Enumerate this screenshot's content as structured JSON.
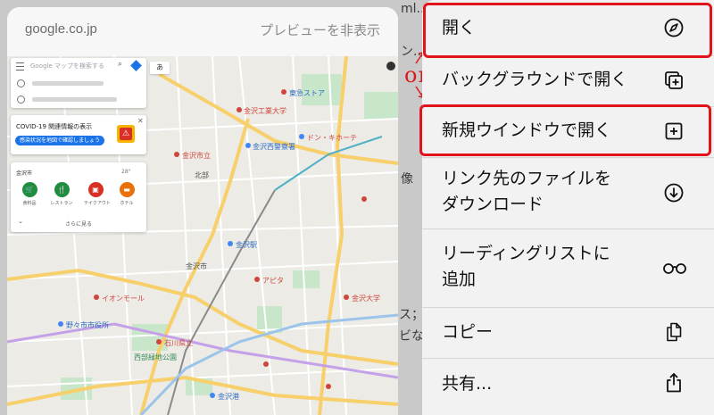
{
  "background": {
    "fragments": [
      "ml...",
      "ン...",
      "像",
      "ス；利",
      "ビな"
    ]
  },
  "preview": {
    "url": "google.co.jp",
    "hide_label": "プレビューを非表示"
  },
  "maps": {
    "search_placeholder": "Google マップを検索する",
    "chip_label": "あ",
    "covid": {
      "title": "COVID-19 関連情報の表示",
      "button": "感染状況を地図で確認しましょう"
    },
    "nearby": {
      "title": "金沢市",
      "temp": "28°",
      "categories": [
        {
          "label": "食料品",
          "color": "#1e8e3e",
          "icon": "cart-icon"
        },
        {
          "label": "レストラン",
          "color": "#1e8e3e",
          "icon": "fork-knife-icon"
        },
        {
          "label": "テイクアウト",
          "color": "#d93025",
          "icon": "takeout-icon"
        },
        {
          "label": "ホテル",
          "color": "#e8710a",
          "icon": "bed-icon"
        }
      ],
      "more": "さらに見る"
    },
    "labels": [
      "金沢工業大学",
      "東急ストア",
      "北部",
      "金沢西警察署",
      "金沢市立",
      "ドン・キホーテ",
      "金沢駅",
      "アピタ",
      "金沢大学",
      "イオンモール",
      "野々市市役所",
      "金沢市",
      "石川県立",
      "西部緑地公園",
      "金沢港"
    ]
  },
  "annotation": {
    "text": "or"
  },
  "menu": {
    "items": [
      {
        "lines": [
          "開く"
        ],
        "icon": "compass-icon"
      },
      {
        "lines": [
          "バックグラウンドで開く"
        ],
        "icon": "tabs-plus-icon"
      },
      {
        "lines": [
          "新規ウインドウで開く"
        ],
        "icon": "square-plus-icon"
      },
      {
        "lines": [
          "リンク先のファイルを",
          "ダウンロード"
        ],
        "icon": "download-icon"
      },
      {
        "lines": [
          "リーディングリストに",
          "追加"
        ],
        "icon": "glasses-icon"
      },
      {
        "lines": [
          "コピー"
        ],
        "icon": "copy-icon"
      },
      {
        "lines": [
          "共有..."
        ],
        "icon": "share-icon"
      }
    ]
  },
  "colors": {
    "highlight": "#e0141b",
    "menu_bg": "#f2f2f2"
  }
}
